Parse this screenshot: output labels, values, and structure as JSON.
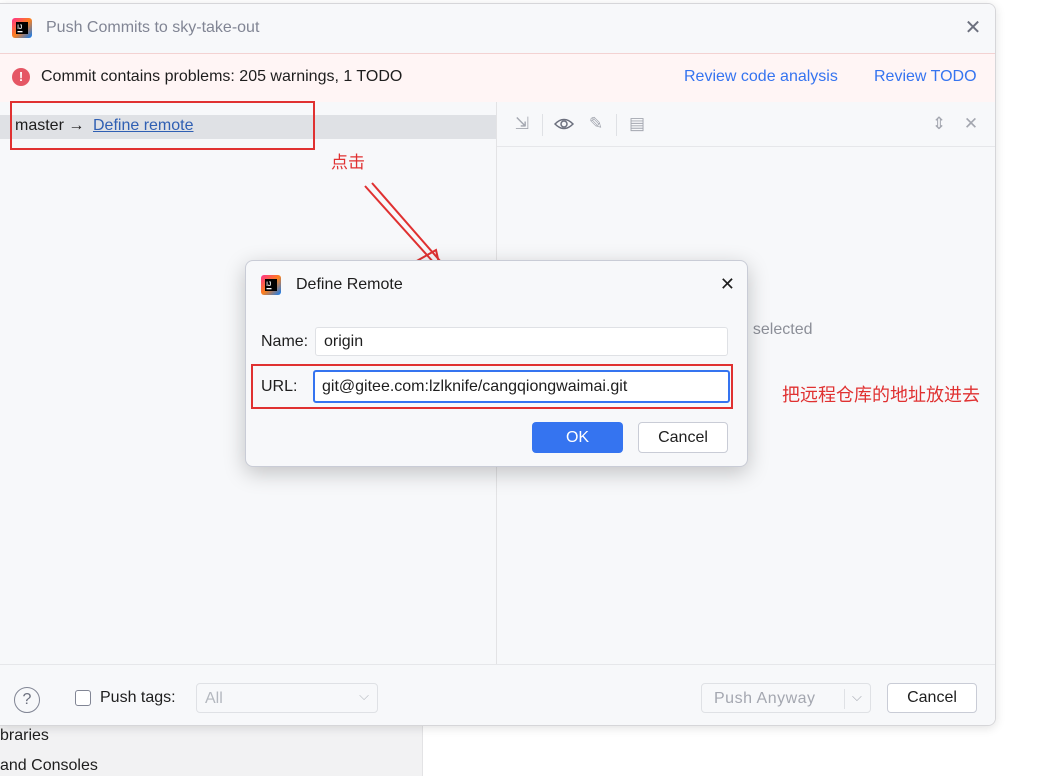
{
  "window": {
    "title": "Push Commits to sky-take-out",
    "close_glyph": "✕"
  },
  "banner": {
    "icon": "error-icon",
    "text": "Commit contains problems: 205 warnings, 1 TODO",
    "link_review_code": "Review code analysis",
    "link_review_todo": "Review TODO"
  },
  "tree": {
    "branch": "master →",
    "define_remote_link": "Define remote"
  },
  "details": {
    "empty_text": "ts selected"
  },
  "footer": {
    "help_glyph": "?",
    "push_tags_label": "Push tags:",
    "push_tags_value": "All",
    "push_anyway": "Push Anyway",
    "cancel": "Cancel"
  },
  "define_remote_dialog": {
    "title": "Define Remote",
    "name_label": "Name:",
    "name_value": "origin",
    "url_label": "URL:",
    "url_value": "git@gitee.com:lzlknife/cangqiongwaimai.git",
    "ok": "OK",
    "cancel": "Cancel",
    "close_glyph": "✕"
  },
  "annotations": {
    "click": "点击",
    "url_hint": "把远程仓库的地址放进去",
    "color": "#e03131"
  },
  "background": {
    "libraries": "braries",
    "consoles": "and Consoles"
  },
  "colors": {
    "accent": "#3574f0",
    "error": "#e55765",
    "banner_bg": "#fff5f5"
  }
}
